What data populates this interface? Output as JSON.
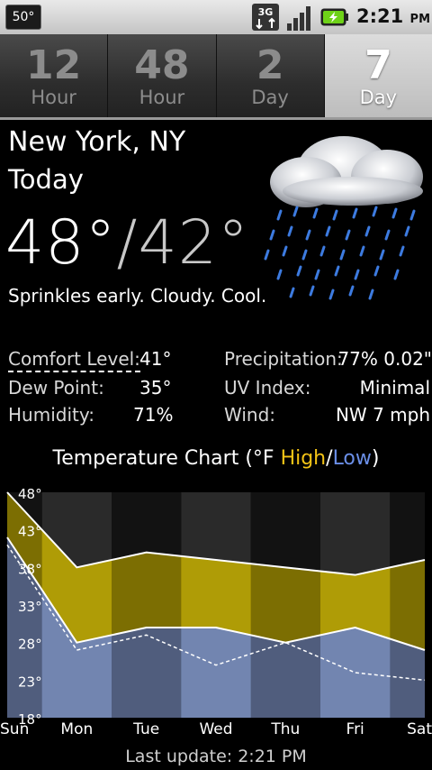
{
  "status_bar": {
    "temp_badge": "50°",
    "network": "3G",
    "time": "2:21",
    "ampm": "PM"
  },
  "tabs": [
    {
      "num": "12",
      "label": "Hour",
      "active": false
    },
    {
      "num": "48",
      "label": "Hour",
      "active": false
    },
    {
      "num": "2",
      "label": "Day",
      "active": false
    },
    {
      "num": "7",
      "label": "Day",
      "active": true
    }
  ],
  "location": "New York, NY",
  "day": "Today",
  "temps": {
    "high": "48°",
    "sep": "/",
    "low": "42°"
  },
  "condition": "Sprinkles early. Cloudy. Cool.",
  "details": {
    "comfort_label": "Comfort Level:",
    "comfort": "41°",
    "dew_label": "Dew Point:",
    "dew": "35°",
    "humidity_label": "Humidity:",
    "humidity": "71%",
    "precip_label": "Precipitation:",
    "precip": "77% 0.02\"",
    "uv_label": "UV Index:",
    "uv": "Minimal",
    "wind_label": "Wind:",
    "wind": "NW 7 mph"
  },
  "chart_title": {
    "prefix": "Temperature Chart (°F ",
    "high": "High",
    "slash": "/",
    "low": "Low",
    "suffix": ")"
  },
  "chart_data": {
    "type": "area",
    "categories": [
      "Sun",
      "Mon",
      "Tue",
      "Wed",
      "Thu",
      "Fri",
      "Sat"
    ],
    "series": [
      {
        "name": "High",
        "values": [
          48,
          38,
          40,
          39,
          38,
          37,
          39
        ],
        "color": "#f3c316"
      },
      {
        "name": "Low",
        "values": [
          42,
          28,
          30,
          30,
          28,
          30,
          27
        ],
        "color": "#6b8fe8"
      },
      {
        "values": [
          41,
          27,
          29,
          25,
          28,
          24,
          23
        ]
      }
    ],
    "y_ticks": [
      "48°",
      "43°",
      "38°",
      "33°",
      "28°",
      "23°",
      "18°"
    ],
    "ylim": [
      18,
      48
    ]
  },
  "last_update": "Last update: 2:21 PM"
}
